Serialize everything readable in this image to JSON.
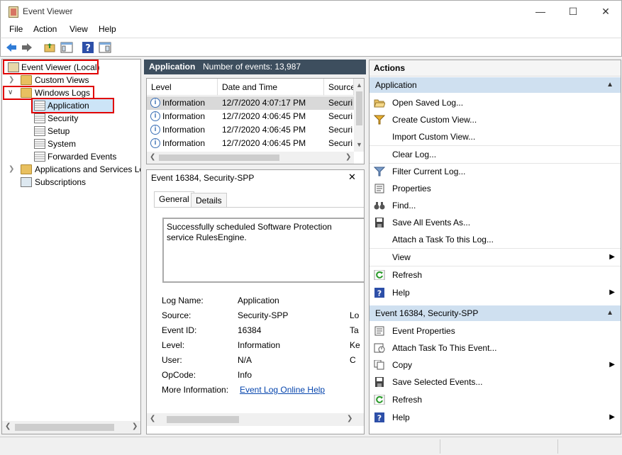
{
  "window": {
    "title": "Event Viewer",
    "minimize": "—",
    "maximize": "☐",
    "close": "✕"
  },
  "menu": [
    "File",
    "Action",
    "View",
    "Help"
  ],
  "tree": {
    "root": "Event Viewer (Local)",
    "custom_views": "Custom Views",
    "windows_logs": "Windows Logs",
    "logs": [
      "Application",
      "Security",
      "Setup",
      "System",
      "Forwarded Events"
    ],
    "apps_services": "Applications and Services Lo",
    "subscriptions": "Subscriptions"
  },
  "log_header": {
    "name": "Application",
    "count_text": "Number of events: 13,987"
  },
  "columns": [
    "Level",
    "Date and Time",
    "Source"
  ],
  "events": [
    {
      "level": "Information",
      "datetime": "12/7/2020 4:07:17 PM",
      "source": "Securi"
    },
    {
      "level": "Information",
      "datetime": "12/7/2020 4:06:45 PM",
      "source": "Securi"
    },
    {
      "level": "Information",
      "datetime": "12/7/2020 4:06:45 PM",
      "source": "Securi"
    },
    {
      "level": "Information",
      "datetime": "12/7/2020 4:06:45 PM",
      "source": "Securi"
    }
  ],
  "detail": {
    "title": "Event 16384, Security-SPP",
    "tabs": [
      "General",
      "Details"
    ],
    "message": "Successfully scheduled Software Protection service RulesEngine.",
    "fields": [
      {
        "label": "Log Name:",
        "value": "Application",
        "extra": ""
      },
      {
        "label": "Source:",
        "value": "Security-SPP",
        "extra": "Lo"
      },
      {
        "label": "Event ID:",
        "value": "16384",
        "extra": "Ta"
      },
      {
        "label": "Level:",
        "value": "Information",
        "extra": "Ke"
      },
      {
        "label": "User:",
        "value": "N/A",
        "extra": "C"
      },
      {
        "label": "OpCode:",
        "value": "Info",
        "extra": ""
      }
    ],
    "more_info_label": "More Information:",
    "more_info_link": "Event Log Online Help"
  },
  "actions": {
    "title": "Actions",
    "section1": "Application",
    "items1": [
      "Open Saved Log...",
      "Create Custom View...",
      "Import Custom View...",
      "Clear Log...",
      "Filter Current Log...",
      "Properties",
      "Find...",
      "Save All Events As...",
      "Attach a Task To this Log...",
      "View",
      "Refresh",
      "Help"
    ],
    "section2": "Event 16384, Security-SPP",
    "items2": [
      "Event Properties",
      "Attach Task To This Event...",
      "Copy",
      "Save Selected Events...",
      "Refresh",
      "Help"
    ]
  },
  "colors": {
    "accent": "#3d4e5e",
    "highlight": "#e00000",
    "selection": "#cce4f7",
    "section_header": "#cfe0f0"
  }
}
